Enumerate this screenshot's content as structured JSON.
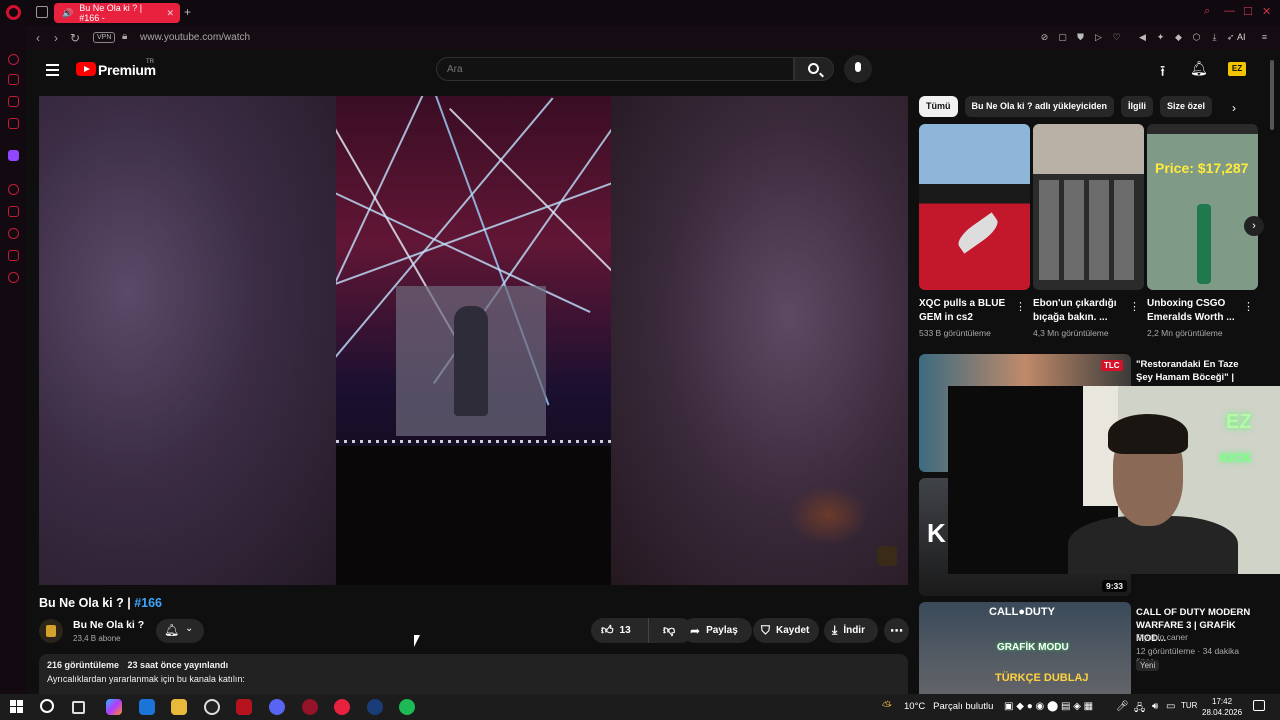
{
  "browser": {
    "tab_title": "Bu Ne Ola ki ? | #166 -",
    "url": "www.youtube.com/watch",
    "vpn_label": "VPN",
    "ai_label": "AI"
  },
  "youtube": {
    "brand": "Premium",
    "region": "TR",
    "search_placeholder": "Ara"
  },
  "video": {
    "title_main": "Bu Ne Ola ki ? |",
    "title_tag": "#166",
    "channel_name": "Bu Ne Ola ki ?",
    "subscribers": "23,4 B abone",
    "like_count": "13",
    "share_label": "Paylaş",
    "save_label": "Kaydet",
    "download_label": "İndir",
    "views": "216 görüntüleme",
    "published": "23 saat önce yayınlandı",
    "description_line": "Ayrıcalıklardan yararlanmak için bu kanala katılın:"
  },
  "chips": [
    "Tümü",
    "Bu Ne Ola ki ? adlı yükleyiciden",
    "İlgili",
    "Size özel"
  ],
  "shelf": [
    {
      "title": "XQC pulls a BLUE GEM in cs2",
      "views": "533 B görüntüleme"
    },
    {
      "title": "Ebon'un çıkardığı bıçağa bakın. ...",
      "views": "4,3 Mn görüntüleme"
    },
    {
      "title": "Unboxing CSGO Emeralds Worth ...",
      "views": "2,2 Mn görüntüleme",
      "price_text": "Price: $17,287"
    }
  ],
  "recommendations": [
    {
      "title": "\"Restorandaki En Taze Şey Hamam Böceği\" | Gordon ...",
      "thumb_badge": "TLC"
    },
    {
      "duration": "9:33",
      "thumb_text": "K"
    },
    {
      "title": "CALL OF DUTY MODERN WARFARE 3 | GRAFİK MOD...",
      "channel": "Diyablo caner",
      "meta": "12 görüntüleme · 34 dakika önce",
      "badge": "Yeni",
      "thumb_top": "CALL●DUTY",
      "thumb_mid": "GRAFİK MODU",
      "thumb_bottom": "TÜRKÇE DUBLAJ"
    }
  ],
  "webcam": {
    "ez": "EZ",
    "kick": "KICK"
  },
  "taskbar": {
    "temperature": "10°C",
    "weather": "Parçalı bulutlu",
    "language": "TUR",
    "time": "17:42",
    "date": "28.04.2026"
  },
  "colors": {
    "accent": "#ff0000",
    "opera_red": "#e8213e",
    "link_blue": "#3ea6ff"
  }
}
